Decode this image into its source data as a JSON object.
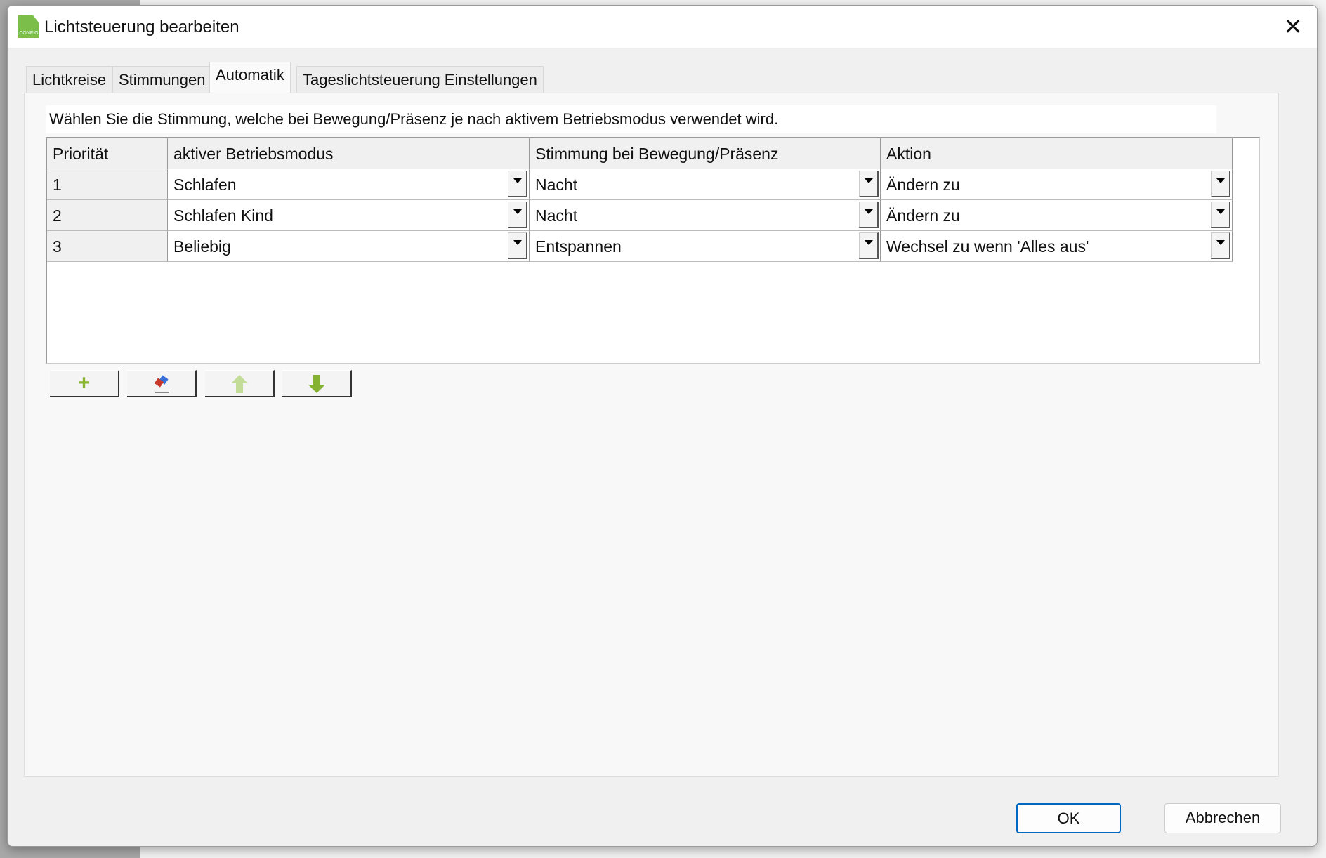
{
  "dialog": {
    "title": "Lichtsteuerung bearbeiten",
    "icon_label": "CONFIG"
  },
  "tabs": [
    {
      "label": "Lichtkreise"
    },
    {
      "label": "Stimmungen"
    },
    {
      "label": "Automatik",
      "active": true
    },
    {
      "label": "Tageslichtsteuerung Einstellungen"
    }
  ],
  "description": "Wählen Sie die Stimmung, welche bei Bewegung/Präsenz je nach aktivem Betriebsmodus verwendet wird.",
  "table": {
    "headers": [
      "Priorität",
      "aktiver Betriebsmodus",
      "Stimmung bei Bewegung/Präsenz",
      "Aktion"
    ],
    "rows": [
      [
        "1",
        "Schlafen",
        "Nacht",
        "Ändern zu"
      ],
      [
        "2",
        "Schlafen Kind",
        "Nacht",
        "Ändern zu"
      ],
      [
        "3",
        "Beliebig",
        "Entspannen",
        "Wechsel zu wenn 'Alles aus'"
      ]
    ]
  },
  "toolbar": {
    "add": "add-icon",
    "remove": "eraser-icon",
    "up": "arrow-up-icon",
    "down": "arrow-down-icon"
  },
  "buttons": {
    "ok": "OK",
    "cancel": "Abbrechen"
  }
}
